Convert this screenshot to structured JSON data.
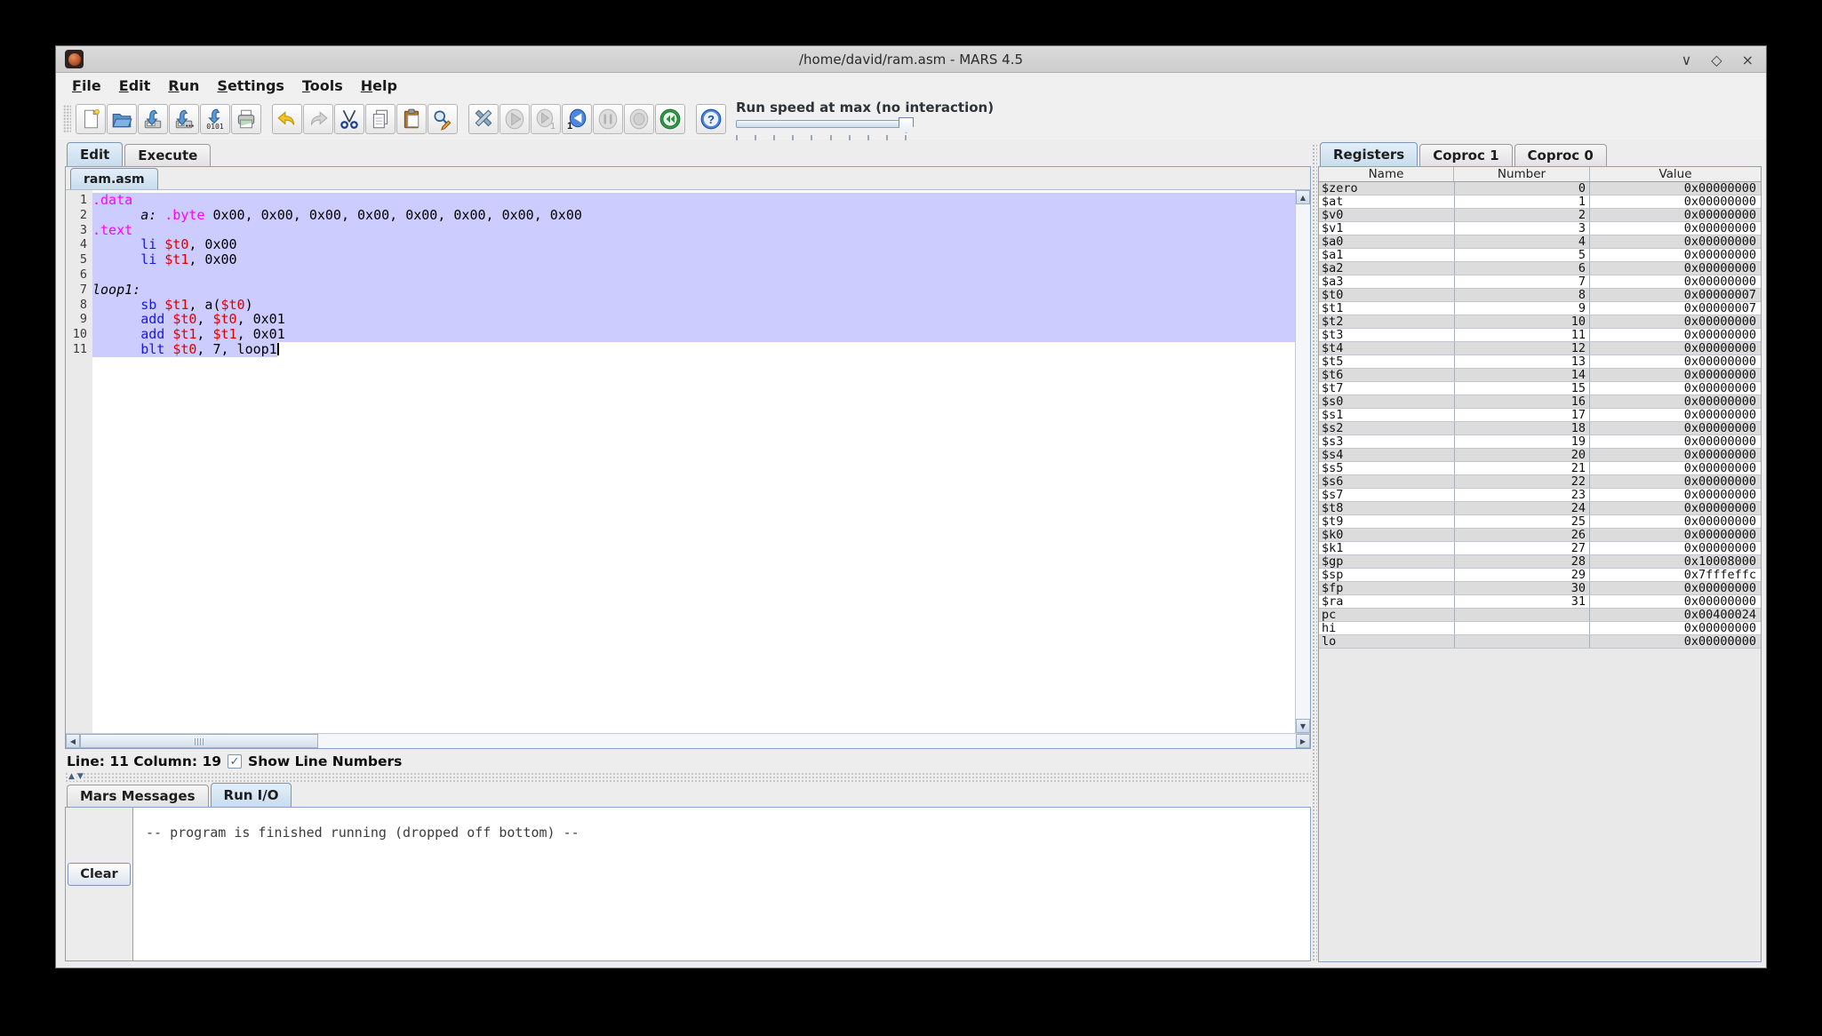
{
  "window": {
    "title": "/home/david/ram.asm - MARS 4.5",
    "controls": {
      "minimize": "∨",
      "maximize": "◇",
      "close": "×"
    }
  },
  "menu": {
    "items": [
      "File",
      "Edit",
      "Run",
      "Settings",
      "Tools",
      "Help"
    ]
  },
  "toolbar": {
    "groups": [
      [
        "new-file",
        "open",
        "save",
        "save-as",
        "dump-memory",
        "print"
      ],
      [
        "undo",
        "redo",
        "cut",
        "copy",
        "paste",
        "find-replace"
      ],
      [
        "assemble",
        "run",
        "step",
        "backstep",
        "pause",
        "stop",
        "reset"
      ],
      [
        "help"
      ]
    ],
    "disabled": [
      "redo",
      "run",
      "step",
      "pause",
      "stop"
    ],
    "speed_label": "Run speed at max (no interaction)"
  },
  "main_tabs": {
    "items": [
      "Edit",
      "Execute"
    ],
    "active": "Edit"
  },
  "editor": {
    "file_tab": "ram.asm",
    "lines": [
      {
        "n": 1,
        "sel": "full",
        "tokens": [
          [
            "dir",
            ".data"
          ]
        ]
      },
      {
        "n": 2,
        "sel": "full",
        "tokens": [
          [
            "plain",
            "      "
          ],
          [
            "label",
            "a:"
          ],
          [
            "plain",
            " "
          ],
          [
            "dir",
            ".byte"
          ],
          [
            "plain",
            " 0x00, 0x00, 0x00, 0x00, 0x00, 0x00, 0x00, 0x00"
          ]
        ]
      },
      {
        "n": 3,
        "sel": "full",
        "tokens": [
          [
            "dir",
            ".text"
          ]
        ]
      },
      {
        "n": 4,
        "sel": "full",
        "tokens": [
          [
            "plain",
            "      "
          ],
          [
            "instr",
            "li"
          ],
          [
            "plain",
            " "
          ],
          [
            "reg",
            "$t0"
          ],
          [
            "plain",
            ", 0x00"
          ]
        ]
      },
      {
        "n": 5,
        "sel": "full",
        "tokens": [
          [
            "plain",
            "      "
          ],
          [
            "instr",
            "li"
          ],
          [
            "plain",
            " "
          ],
          [
            "reg",
            "$t1"
          ],
          [
            "plain",
            ", 0x00"
          ]
        ]
      },
      {
        "n": 6,
        "sel": "full",
        "tokens": []
      },
      {
        "n": 7,
        "sel": "full",
        "tokens": [
          [
            "label",
            "loop1:"
          ]
        ]
      },
      {
        "n": 8,
        "sel": "full",
        "tokens": [
          [
            "plain",
            "      "
          ],
          [
            "instr",
            "sb"
          ],
          [
            "plain",
            " "
          ],
          [
            "reg",
            "$t1"
          ],
          [
            "plain",
            ", a("
          ],
          [
            "reg",
            "$t0"
          ],
          [
            "plain",
            ")"
          ]
        ]
      },
      {
        "n": 9,
        "sel": "full",
        "tokens": [
          [
            "plain",
            "      "
          ],
          [
            "instr",
            "add"
          ],
          [
            "plain",
            " "
          ],
          [
            "reg",
            "$t0"
          ],
          [
            "plain",
            ", "
          ],
          [
            "reg",
            "$t0"
          ],
          [
            "plain",
            ", 0x01"
          ]
        ]
      },
      {
        "n": 10,
        "sel": "full",
        "tokens": [
          [
            "plain",
            "      "
          ],
          [
            "instr",
            "add"
          ],
          [
            "plain",
            " "
          ],
          [
            "reg",
            "$t1"
          ],
          [
            "plain",
            ", "
          ],
          [
            "reg",
            "$t1"
          ],
          [
            "plain",
            ", 0x01"
          ]
        ]
      },
      {
        "n": 11,
        "sel": "text",
        "cursor": true,
        "tokens": [
          [
            "plain",
            "      "
          ],
          [
            "instr",
            "blt"
          ],
          [
            "plain",
            " "
          ],
          [
            "reg",
            "$t0"
          ],
          [
            "plain",
            ", 7, loop1"
          ]
        ]
      }
    ]
  },
  "status": {
    "position": "Line: 11 Column: 19",
    "show_line_numbers_label": "Show Line Numbers",
    "show_line_numbers_checked": true,
    "check_glyph": "✓"
  },
  "console": {
    "tabs": [
      "Mars Messages",
      "Run I/O"
    ],
    "active": "Run I/O",
    "clear_label": "Clear",
    "message": "-- program is finished running (dropped off bottom) --"
  },
  "registers": {
    "tabs": [
      "Registers",
      "Coproc 1",
      "Coproc 0"
    ],
    "active": "Registers",
    "columns": [
      "Name",
      "Number",
      "Value"
    ],
    "rows": [
      [
        "$zero",
        "0",
        "0x00000000"
      ],
      [
        "$at",
        "1",
        "0x00000000"
      ],
      [
        "$v0",
        "2",
        "0x00000000"
      ],
      [
        "$v1",
        "3",
        "0x00000000"
      ],
      [
        "$a0",
        "4",
        "0x00000000"
      ],
      [
        "$a1",
        "5",
        "0x00000000"
      ],
      [
        "$a2",
        "6",
        "0x00000000"
      ],
      [
        "$a3",
        "7",
        "0x00000000"
      ],
      [
        "$t0",
        "8",
        "0x00000007"
      ],
      [
        "$t1",
        "9",
        "0x00000007"
      ],
      [
        "$t2",
        "10",
        "0x00000000"
      ],
      [
        "$t3",
        "11",
        "0x00000000"
      ],
      [
        "$t4",
        "12",
        "0x00000000"
      ],
      [
        "$t5",
        "13",
        "0x00000000"
      ],
      [
        "$t6",
        "14",
        "0x00000000"
      ],
      [
        "$t7",
        "15",
        "0x00000000"
      ],
      [
        "$s0",
        "16",
        "0x00000000"
      ],
      [
        "$s1",
        "17",
        "0x00000000"
      ],
      [
        "$s2",
        "18",
        "0x00000000"
      ],
      [
        "$s3",
        "19",
        "0x00000000"
      ],
      [
        "$s4",
        "20",
        "0x00000000"
      ],
      [
        "$s5",
        "21",
        "0x00000000"
      ],
      [
        "$s6",
        "22",
        "0x00000000"
      ],
      [
        "$s7",
        "23",
        "0x00000000"
      ],
      [
        "$t8",
        "24",
        "0x00000000"
      ],
      [
        "$t9",
        "25",
        "0x00000000"
      ],
      [
        "$k0",
        "26",
        "0x00000000"
      ],
      [
        "$k1",
        "27",
        "0x00000000"
      ],
      [
        "$gp",
        "28",
        "0x10008000"
      ],
      [
        "$sp",
        "29",
        "0x7fffeffc"
      ],
      [
        "$fp",
        "30",
        "0x00000000"
      ],
      [
        "$ra",
        "31",
        "0x00000000"
      ],
      [
        "pc",
        "",
        "0x00400024"
      ],
      [
        "hi",
        "",
        "0x00000000"
      ],
      [
        "lo",
        "",
        "0x00000000"
      ]
    ]
  },
  "colors": {
    "selection": "#ccccfe",
    "directive": "#ff00ff",
    "instruction": "#1717e6",
    "register": "#e00000",
    "selected_tab": "#cfe3f5"
  }
}
